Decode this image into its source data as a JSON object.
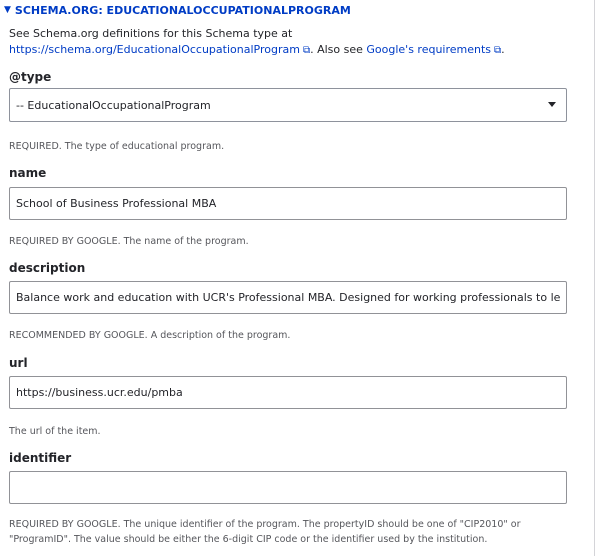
{
  "section": {
    "title": "SCHEMA.ORG: EDUCATIONALOCCUPATIONALPROGRAM",
    "description_prefix": "See Schema.org definitions for this Schema type at",
    "definition_link": "https://schema.org/EducationalOccupationalProgram",
    "also_see": ". Also see ",
    "requirements_link": "Google's requirements",
    "period": ".",
    "external_icon": "external-link-icon"
  },
  "fields": {
    "type": {
      "label": "@type",
      "value": "-- EducationalOccupationalProgram",
      "help": "REQUIRED. The type of educational program."
    },
    "name": {
      "label": "name",
      "value": "School of Business Professional MBA",
      "help": "REQUIRED BY GOOGLE. The name of the program."
    },
    "description": {
      "label": "description",
      "value": "Balance work and education with UCR's Professional MBA. Designed for working professionals to le",
      "help": "RECOMMENDED BY GOOGLE. A description of the program."
    },
    "url": {
      "label": "url",
      "value": "https://business.ucr.edu/pmba",
      "help": "The url of the item."
    },
    "identifier": {
      "label": "identifier",
      "value": "",
      "help": "REQUIRED BY GOOGLE. The unique identifier of the program. The propertyID should be one of \"CIP2010\" or \"ProgramID\". The value should be either the 6-digit CIP code or the identifier used by the institution."
    }
  },
  "colors": {
    "link": "#003cc5",
    "text": "#232429",
    "help": "#55565b",
    "border": "#919297"
  }
}
